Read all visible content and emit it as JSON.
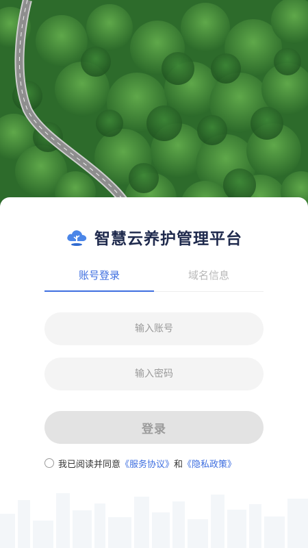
{
  "brand": {
    "title": "智慧云养护管理平台",
    "logo_icon": "cloud-tree-icon",
    "color": "#1f2a4d",
    "logo_color": "#4b86e8"
  },
  "tabs": [
    {
      "label": "账号登录",
      "active": true
    },
    {
      "label": "域名信息",
      "active": false
    }
  ],
  "form": {
    "account_placeholder": "输入账号",
    "password_placeholder": "输入密码",
    "login_label": "登录"
  },
  "agreement": {
    "prefix": "我已阅读并同意",
    "service_link": "《服务协议》",
    "conjunction": "和",
    "privacy_link": "《隐私政策》"
  },
  "colors": {
    "accent": "#3d6ee0",
    "button_disabled": "#e3e3e3",
    "input_bg": "#f4f4f4"
  }
}
